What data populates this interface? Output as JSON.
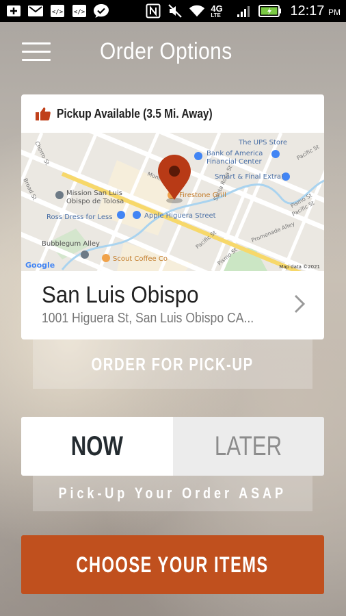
{
  "status_bar": {
    "icons": [
      "add-icon",
      "gmail-icon",
      "code-icon",
      "code-icon",
      "check-bubble-icon",
      "nfc-icon",
      "mute-icon",
      "wifi-icon",
      "lte-icon",
      "signal-icon",
      "battery-icon"
    ],
    "network": "4G",
    "network_sub": "LTE",
    "time": "12:17",
    "ampm": "PM"
  },
  "header": {
    "title": "Order Options"
  },
  "card": {
    "pickup_status": "Pickup Available (3.5 Mi. Away)",
    "map": {
      "attribution": "Map data ©2021",
      "logo": "Google",
      "labels": {
        "ups": "The UPS Store",
        "bank1": "Bank of America",
        "bank2": "Financial Center",
        "smart": "Smart & Final Extra!",
        "mission1": "Mission San Luis",
        "mission2": "Obispo de Tolosa",
        "firestone": "Firestone Grill",
        "ross": "Ross Dress for Less",
        "apple": "Apple Higuera Street",
        "bubblegum": "Bubblegum Alley",
        "scout": "Scout Coffee Co",
        "chorro": "Chorro St",
        "broad": "Broad St",
        "monterey": "Monterey St",
        "santarosa": "Santa Rosa St",
        "pacific": "Pacific St",
        "pismo": "Pismo St",
        "pacific2": "Pacific St",
        "pismo2": "Pismo St",
        "pacific3": "Pacific St",
        "promenade": "Promenade Alley"
      }
    },
    "location_name": "San Luis Obispo",
    "location_address": "1001 Higuera St, San Luis Obispo CA..."
  },
  "order_button": "ORDER FOR PICK-UP",
  "timing": {
    "now": "NOW",
    "later": "LATER",
    "selected": "NOW",
    "caption": "Pick-Up Your Order ASAP"
  },
  "choose_button": "CHOOSE YOUR ITEMS",
  "colors": {
    "accent": "#c0501e",
    "pin": "#b83a16",
    "dark_text": "#242b30",
    "inactive_text": "#8c8c8c"
  }
}
